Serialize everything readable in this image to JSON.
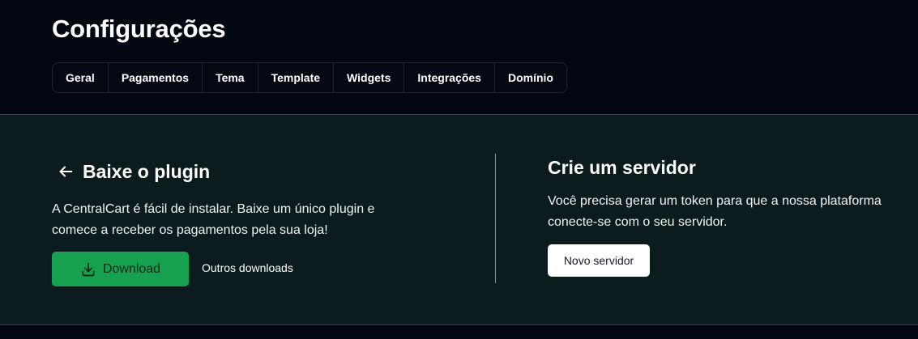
{
  "page": {
    "title": "Configurações"
  },
  "tabs": [
    {
      "label": "Geral"
    },
    {
      "label": "Pagamentos"
    },
    {
      "label": "Tema"
    },
    {
      "label": "Template"
    },
    {
      "label": "Widgets"
    },
    {
      "label": "Integrações"
    },
    {
      "label": "Domínio"
    }
  ],
  "plugin": {
    "heading": "Baixe o plugin",
    "description": "A CentralCart é fácil de instalar. Baixe um único plugin e comece a receber os pagamentos pela sua loja!",
    "download_label": "Download",
    "other_downloads_label": "Outros downloads",
    "back_icon": "arrow-left-icon",
    "download_icon": "download-icon"
  },
  "server": {
    "heading": "Crie um servidor",
    "description": "Você precisa gerar um token para que a nossa plataforma conecte-se com o seu servidor.",
    "button_label": "Novo servidor"
  },
  "colors": {
    "background": "#020611",
    "panel": "#0c1b1d",
    "accent_green": "#16a150",
    "button_white": "#ffffff"
  }
}
